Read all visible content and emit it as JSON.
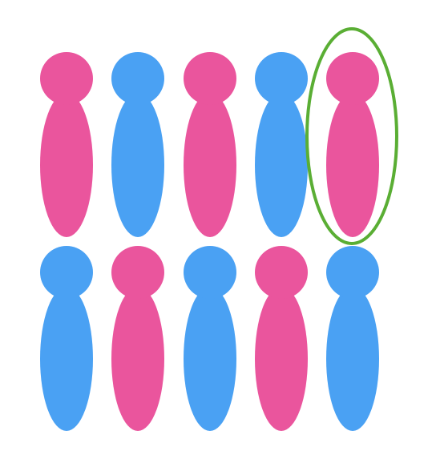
{
  "colors": {
    "background": "#ffffff",
    "pink": "#ea559d",
    "blue": "#4aa1f3",
    "highlight": "#5aae34"
  },
  "rows": [
    {
      "figures": [
        {
          "color": "pink",
          "highlighted": false
        },
        {
          "color": "blue",
          "highlighted": false
        },
        {
          "color": "pink",
          "highlighted": false
        },
        {
          "color": "blue",
          "highlighted": false
        },
        {
          "color": "pink",
          "highlighted": true
        }
      ]
    },
    {
      "figures": [
        {
          "color": "blue",
          "highlighted": false
        },
        {
          "color": "pink",
          "highlighted": false
        },
        {
          "color": "blue",
          "highlighted": false
        },
        {
          "color": "pink",
          "highlighted": false
        },
        {
          "color": "blue",
          "highlighted": false
        }
      ]
    }
  ]
}
